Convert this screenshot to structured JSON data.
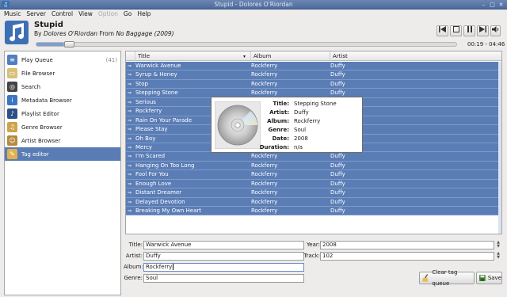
{
  "window": {
    "title": "Stupid - Dolores O'Riordan"
  },
  "menu": [
    {
      "label": "Music",
      "disabled": false
    },
    {
      "label": "Server",
      "disabled": false
    },
    {
      "label": "Control",
      "disabled": false
    },
    {
      "label": "View",
      "disabled": false
    },
    {
      "label": "Option",
      "disabled": true
    },
    {
      "label": "Go",
      "disabled": false
    },
    {
      "label": "Help",
      "disabled": false
    }
  ],
  "now_playing": {
    "title": "Stupid",
    "by_label": "By",
    "artist": "Dolores O'Riordan",
    "from_label": "From",
    "album": "No Baggage (2009)",
    "time": "00:19 - 04:46",
    "progress_fraction": 0.066
  },
  "controls": [
    "prev-icon",
    "stop-icon",
    "pause-icon",
    "next-icon",
    "volume-icon"
  ],
  "sidebar": {
    "items": [
      {
        "label": "Play Queue",
        "count": "(41)",
        "icon": "queue-icon",
        "color": "#4f7fbf"
      },
      {
        "label": "File Browser",
        "count": "",
        "icon": "folder-icon",
        "color": "#d8c07a"
      },
      {
        "label": "Search",
        "count": "",
        "icon": "binoculars-icon",
        "color": "#444444"
      },
      {
        "label": "Metadata Browser",
        "count": "",
        "icon": "info-icon",
        "color": "#3d74c4"
      },
      {
        "label": "Playlist Editor",
        "count": "",
        "icon": "playlist-icon",
        "color": "#2e4f86"
      },
      {
        "label": "Genre Browser",
        "count": "",
        "icon": "genre-icon",
        "color": "#cfa34a"
      },
      {
        "label": "Artist Browser",
        "count": "",
        "icon": "artist-icon",
        "color": "#b58a3a"
      },
      {
        "label": "Tag editor",
        "count": "",
        "icon": "tag-icon",
        "color": "#e0b24f",
        "selected": true
      }
    ]
  },
  "table": {
    "columns": [
      "Title",
      "Album",
      "Artist"
    ],
    "rows": [
      {
        "title": "Warwick Avenue",
        "album": "Rockferry",
        "artist": "Duffy"
      },
      {
        "title": "Syrup & Honey",
        "album": "Rockferry",
        "artist": "Duffy"
      },
      {
        "title": "Stop",
        "album": "Rockferry",
        "artist": "Duffy"
      },
      {
        "title": "Stepping Stone",
        "album": "Rockferry",
        "artist": "Duffy"
      },
      {
        "title": "Serious",
        "album": "",
        "artist": "Duffy"
      },
      {
        "title": "Rockferry",
        "album": "",
        "artist": "Duffy"
      },
      {
        "title": "Rain On Your Parade",
        "album": "",
        "artist": "Duffy"
      },
      {
        "title": "Please Stay",
        "album": "",
        "artist": "Duffy"
      },
      {
        "title": "Oh Boy",
        "album": "",
        "artist": "Duffy"
      },
      {
        "title": "Mercy",
        "album": "",
        "artist": "Duffy"
      },
      {
        "title": "I'm Scared",
        "album": "Rockferry",
        "artist": "Duffy"
      },
      {
        "title": "Hanging On Too Long",
        "album": "Rockferry",
        "artist": "Duffy"
      },
      {
        "title": "Fool For You",
        "album": "Rockferry",
        "artist": "Duffy"
      },
      {
        "title": "Enough Love",
        "album": "Rockferry",
        "artist": "Duffy"
      },
      {
        "title": "Distant Dreamer",
        "album": "Rockferry",
        "artist": "Duffy"
      },
      {
        "title": "Delayed Devotion",
        "album": "Rockferry",
        "artist": "Duffy"
      },
      {
        "title": "Breaking My Own Heart",
        "album": "Rockferry",
        "artist": "Duffy"
      }
    ]
  },
  "tooltip": {
    "rows": [
      {
        "key": "Title:",
        "value": "Stepping Stone"
      },
      {
        "key": "Artist:",
        "value": "Duffy"
      },
      {
        "key": "Album:",
        "value": "Rockferry"
      },
      {
        "key": "Genre:",
        "value": "Soul"
      },
      {
        "key": "Date:",
        "value": "2008"
      },
      {
        "key": "Duration:",
        "value": "n/a"
      }
    ]
  },
  "tag_editor": {
    "title_label": "Title:",
    "title_value": "Warwick Avenue",
    "artist_label": "Artist:",
    "artist_value": "Duffy",
    "album_label": "Album:",
    "album_value": "Rockferry",
    "genre_label": "Genre:",
    "genre_value": "Soul",
    "year_label": "Year:",
    "year_value": "2008",
    "track_label": "Track:",
    "track_value": "102",
    "clear_button": "Clear tag queue",
    "save_button": "Save"
  },
  "colors": {
    "selection": "#5b7db6",
    "accent": "#4e6a9a"
  }
}
